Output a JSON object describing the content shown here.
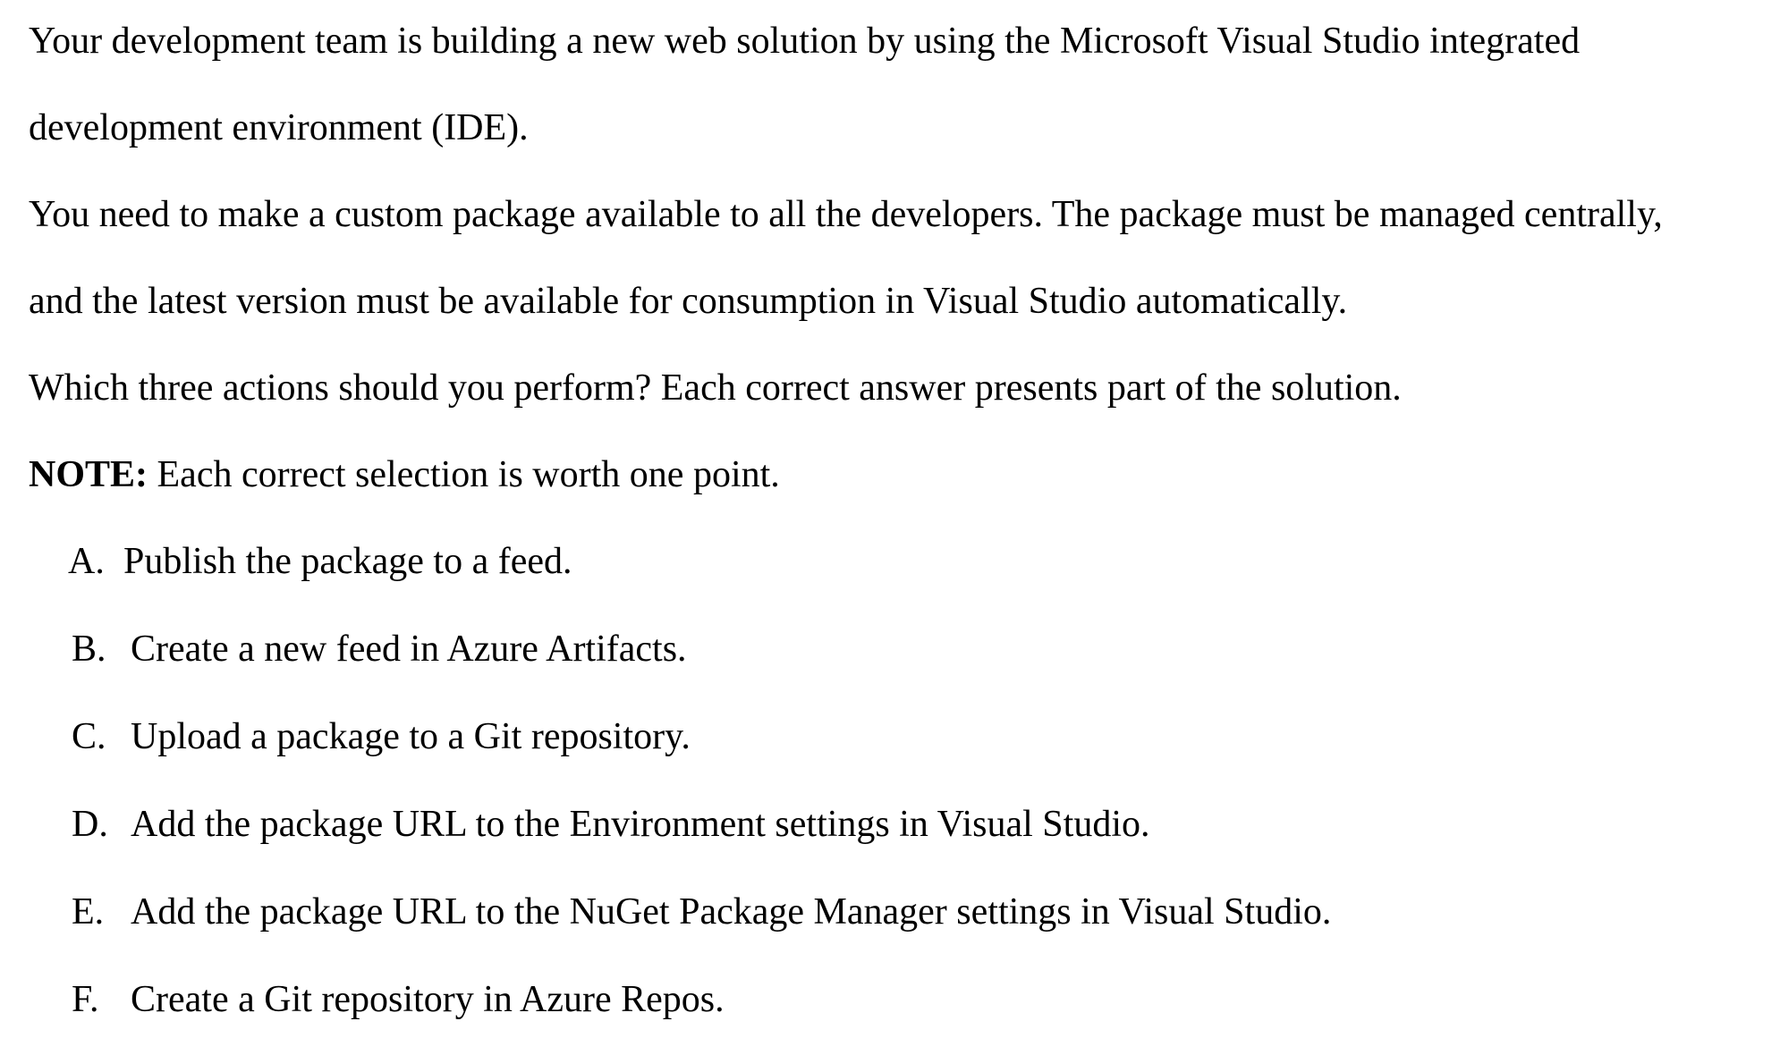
{
  "question": {
    "lines": [
      "Your development team is building a new web solution by using the Microsoft Visual Studio integrated",
      "development environment (IDE).",
      "You need to make a custom package available to all the developers. The package must be managed centrally,",
      "and the latest version must be available for consumption in Visual Studio automatically.",
      "Which three actions should you perform? Each correct answer presents part of the solution."
    ],
    "note_label": "NOTE:",
    "note_text": " Each correct selection is worth one point."
  },
  "options": [
    {
      "letter": "A.",
      "text": "Publish the package to a feed."
    },
    {
      "letter": "B.",
      "text": "Create a new feed in Azure Artifacts."
    },
    {
      "letter": "C.",
      "text": "Upload a package to a Git repository."
    },
    {
      "letter": "D.",
      "text": "Add the package URL to the Environment settings in Visual Studio."
    },
    {
      "letter": "E.",
      "text": "Add the package URL to the NuGet Package Manager settings in Visual Studio."
    },
    {
      "letter": "F.",
      "text": "Create a Git repository in Azure Repos."
    }
  ]
}
